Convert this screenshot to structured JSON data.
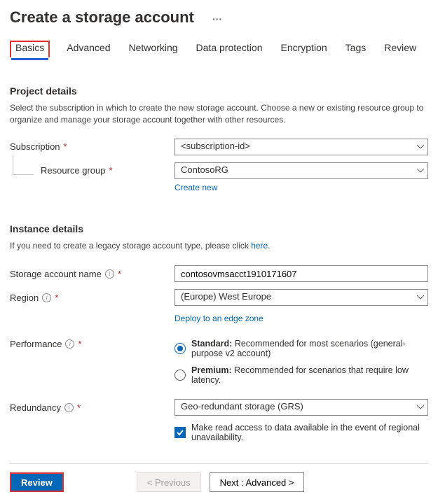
{
  "header": {
    "title": "Create a storage account"
  },
  "tabs": {
    "basics": "Basics",
    "advanced": "Advanced",
    "networking": "Networking",
    "data_protection": "Data protection",
    "encryption": "Encryption",
    "tags": "Tags",
    "review": "Review"
  },
  "project": {
    "heading": "Project details",
    "desc": "Select the subscription in which to create the new storage account. Choose a new or existing resource group to organize and manage your storage account together with other resources.",
    "subscription_label": "Subscription",
    "subscription_value": "<subscription-id>",
    "rg_label": "Resource group",
    "rg_value": "ContosoRG",
    "create_new": "Create new"
  },
  "instance": {
    "heading": "Instance details",
    "legacy_pre": "If you need to create a legacy storage account type, please click ",
    "legacy_link": "here",
    "name_label": "Storage account name",
    "name_value": "contosovmsacct1910171607",
    "region_label": "Region",
    "region_value": "(Europe) West Europe",
    "deploy_edge": "Deploy to an edge zone",
    "perf_label": "Performance",
    "perf_std_bold": "Standard:",
    "perf_std_rest": " Recommended for most scenarios (general-purpose v2 account)",
    "perf_prem_bold": "Premium:",
    "perf_prem_rest": " Recommended for scenarios that require low latency.",
    "redundancy_label": "Redundancy",
    "redundancy_value": "Geo-redundant storage (GRS)",
    "read_access": "Make read access to data available in the event of regional unavailability."
  },
  "footer": {
    "review": "Review",
    "previous": "< Previous",
    "next": "Next : Advanced >"
  }
}
